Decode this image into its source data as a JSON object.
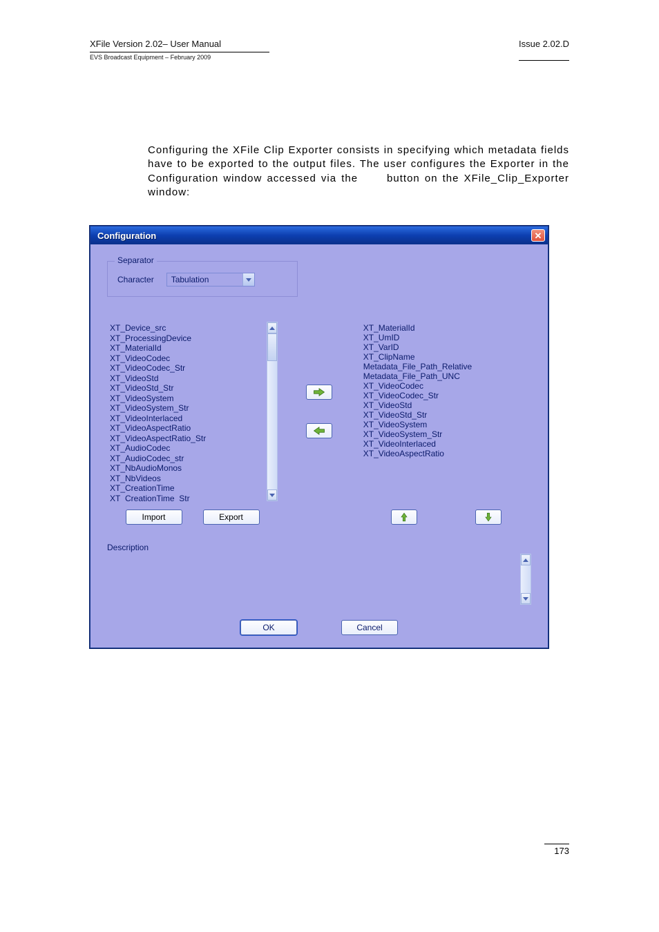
{
  "header": {
    "title_left": "XFile Version 2.02– User Manual",
    "subtitle_left": "EVS Broadcast Equipment – February 2009",
    "title_right": "Issue 2.02.D"
  },
  "body_paragraph": "Configuring the XFile Clip Exporter consists in specifying which metadata fields have to be exported to the output files. The user configures the Exporter in the Configuration window accessed via the",
  "body_paragraph_tail": "button on the XFile_Clip_Exporter window:",
  "dialog": {
    "title": "Configuration",
    "separator_legend": "Separator",
    "separator_label": "Character",
    "separator_value": "Tabulation",
    "left_list": [
      "XT_Device_src",
      "XT_ProcessingDevice",
      "XT_MaterialId",
      "XT_VideoCodec",
      "XT_VideoCodec_Str",
      "XT_VideoStd",
      "XT_VideoStd_Str",
      "XT_VideoSystem",
      "XT_VideoSystem_Str",
      "XT_VideoInterlaced",
      "XT_VideoAspectRatio",
      "XT_VideoAspectRatio_Str",
      "XT_AudioCodec",
      "XT_AudioCodec_str",
      "XT_NbAudioMonos",
      "XT_NbVideos",
      "XT_CreationTime",
      "XT_CreationTime_Str"
    ],
    "right_list": [
      "XT_MaterialId",
      "XT_UmID",
      "XT_VarID",
      "XT_ClipName",
      "Metadata_File_Path_Relative",
      "Metadata_File_Path_UNC",
      "XT_VideoCodec",
      "XT_VideoCodec_Str",
      "XT_VideoStd",
      "XT_VideoStd_Str",
      "XT_VideoSystem",
      "XT_VideoSystem_Str",
      "XT_VideoInterlaced",
      "XT_VideoAspectRatio"
    ],
    "import_label": "Import",
    "export_label": "Export",
    "description_label": "Description",
    "ok_label": "OK",
    "cancel_label": "Cancel"
  },
  "page_number": "173"
}
